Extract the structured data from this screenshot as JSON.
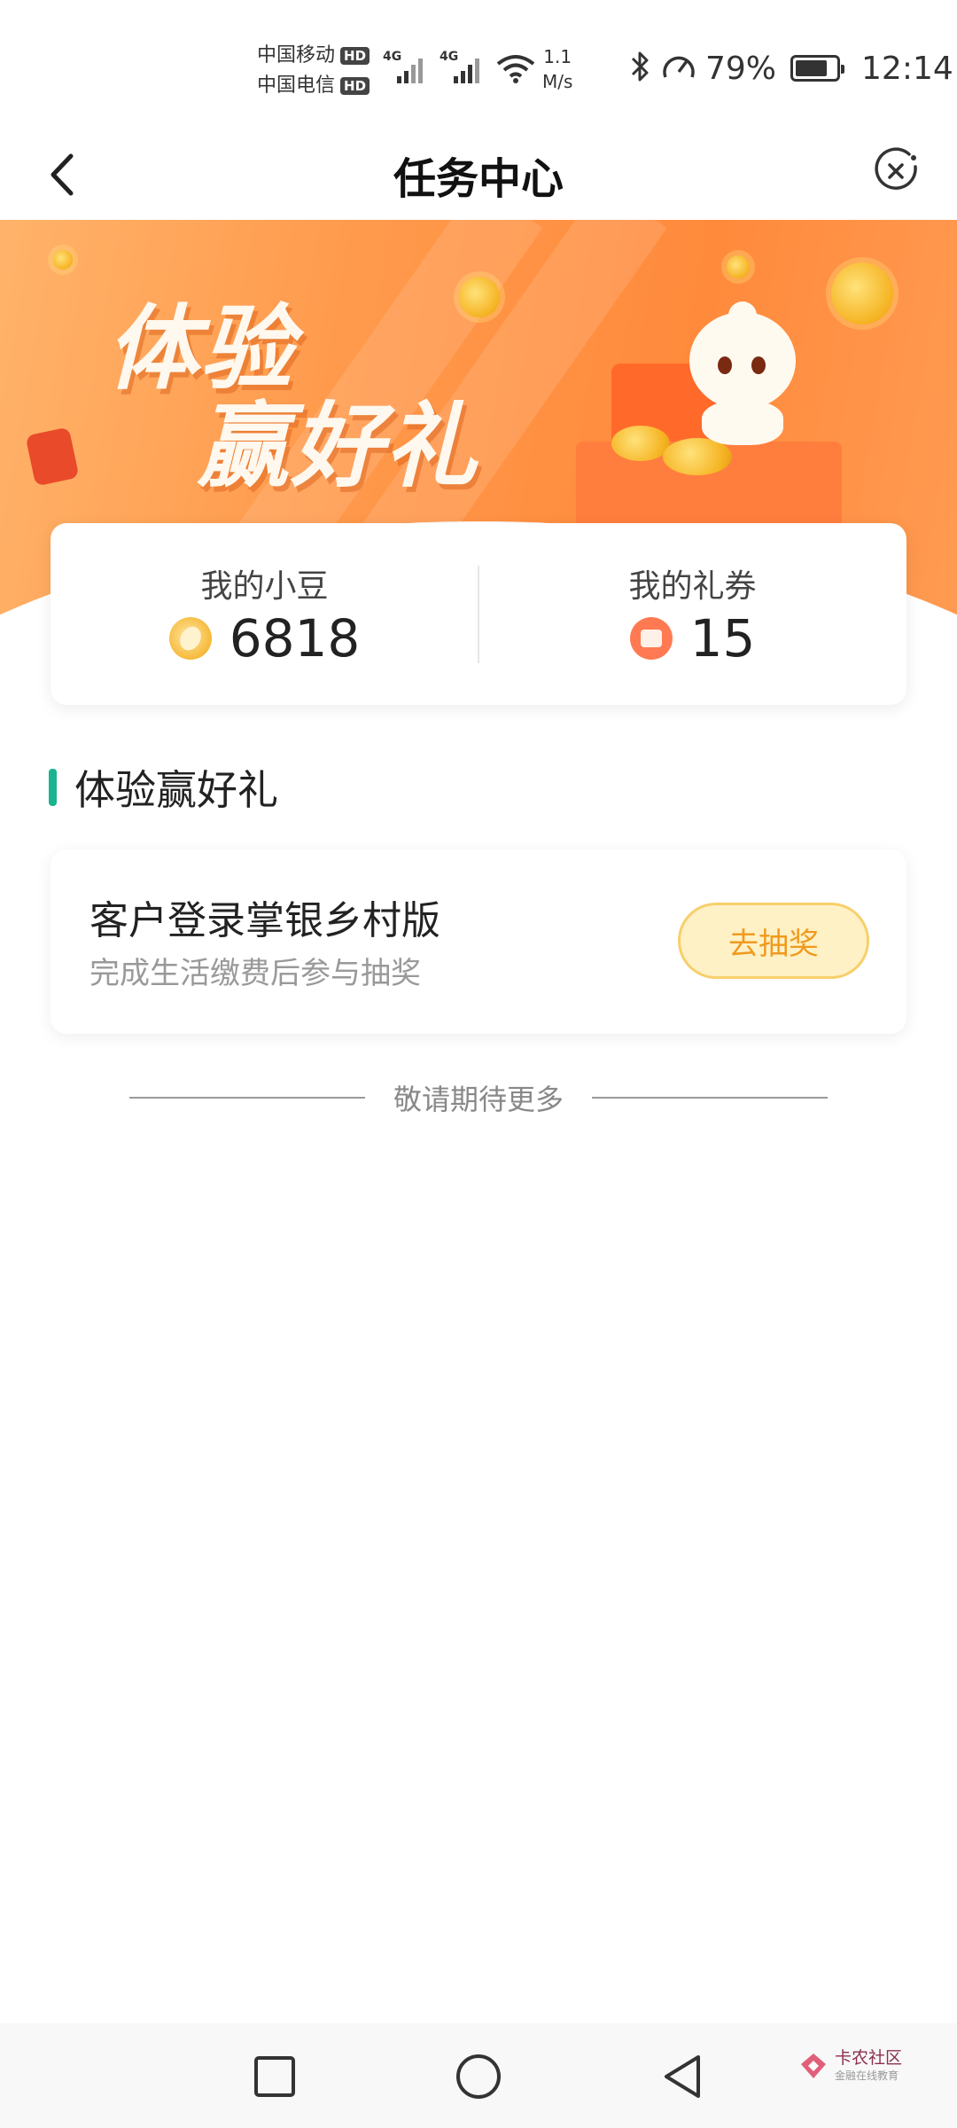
{
  "status_bar": {
    "carrier1": "中国移动",
    "carrier2": "中国电信",
    "hd_badge": "HD",
    "net_type": "4G",
    "speed_value": "1.1",
    "speed_unit": "M/s",
    "battery_percent": "79%",
    "battery_level": 0.79,
    "time": "12:14"
  },
  "nav": {
    "title": "任务中心"
  },
  "banner": {
    "line1": "体验",
    "line2": "赢好礼"
  },
  "points": {
    "beans_label": "我的小豆",
    "beans_value": "6818",
    "coupons_label": "我的礼券",
    "coupons_value": "15"
  },
  "section": {
    "title": "体验赢好礼"
  },
  "task": {
    "title": "客户登录掌银乡村版",
    "description": "完成生活缴费后参与抽奖",
    "button_label": "去抽奖"
  },
  "more_text": "敬请期待更多",
  "watermark": {
    "text": "卡农社区",
    "sub": "金融在线教育"
  },
  "colors": {
    "accent_green": "#18b38f",
    "banner_orange": "#ff8a3c",
    "button_bg": "#fff1c6",
    "button_text": "#f09a1e"
  }
}
